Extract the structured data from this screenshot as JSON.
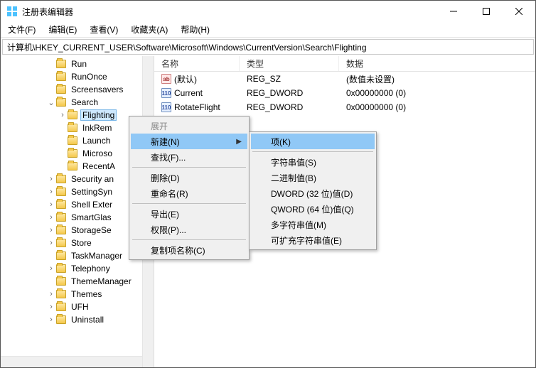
{
  "titlebar": {
    "title": "注册表编辑器"
  },
  "menubar": {
    "file": "文件(F)",
    "edit": "编辑(E)",
    "view": "查看(V)",
    "fav": "收藏夹(A)",
    "help": "帮助(H)"
  },
  "address": "计算机\\HKEY_CURRENT_USER\\Software\\Microsoft\\Windows\\CurrentVersion\\Search\\Flighting",
  "tree": {
    "items": [
      {
        "indent": 4,
        "tw": "",
        "label": "Run"
      },
      {
        "indent": 4,
        "tw": "",
        "label": "RunOnce"
      },
      {
        "indent": 4,
        "tw": "",
        "label": "Screensavers"
      },
      {
        "indent": 4,
        "tw": "v",
        "label": "Search"
      },
      {
        "indent": 5,
        "tw": ">",
        "label": "Flighting",
        "sel": true
      },
      {
        "indent": 5,
        "tw": "",
        "label": "InkRem"
      },
      {
        "indent": 5,
        "tw": "",
        "label": "Launch"
      },
      {
        "indent": 5,
        "tw": "",
        "label": "Microso"
      },
      {
        "indent": 5,
        "tw": "",
        "label": "RecentA"
      },
      {
        "indent": 4,
        "tw": ">",
        "label": "Security an"
      },
      {
        "indent": 4,
        "tw": ">",
        "label": "SettingSyn"
      },
      {
        "indent": 4,
        "tw": ">",
        "label": "Shell Exter"
      },
      {
        "indent": 4,
        "tw": ">",
        "label": "SmartGlas"
      },
      {
        "indent": 4,
        "tw": ">",
        "label": "StorageSe"
      },
      {
        "indent": 4,
        "tw": ">",
        "label": "Store"
      },
      {
        "indent": 4,
        "tw": "",
        "label": "TaskManager"
      },
      {
        "indent": 4,
        "tw": ">",
        "label": "Telephony"
      },
      {
        "indent": 4,
        "tw": "",
        "label": "ThemeManager"
      },
      {
        "indent": 4,
        "tw": ">",
        "label": "Themes"
      },
      {
        "indent": 4,
        "tw": ">",
        "label": "UFH"
      },
      {
        "indent": 4,
        "tw": ">",
        "label": "Uninstall"
      }
    ]
  },
  "list": {
    "headers": {
      "name": "名称",
      "type": "类型",
      "data": "数据"
    },
    "rows": [
      {
        "icon": "sz",
        "name": "(默认)",
        "type": "REG_SZ",
        "data": "(数值未设置)"
      },
      {
        "icon": "dw",
        "name": "Current",
        "type": "REG_DWORD",
        "data": "0x00000000 (0)"
      },
      {
        "icon": "dw",
        "name": "RotateFlight",
        "type": "REG_DWORD",
        "data": "0x00000000 (0)"
      }
    ]
  },
  "ctx1": {
    "expand": "展开",
    "new": "新建(N)",
    "find": "查找(F)...",
    "delete": "删除(D)",
    "rename": "重命名(R)",
    "export": "导出(E)",
    "perm": "权限(P)...",
    "copyname": "复制项名称(C)"
  },
  "ctx2": {
    "key": "项(K)",
    "string": "字符串值(S)",
    "binary": "二进制值(B)",
    "dword": "DWORD (32 位)值(D)",
    "qword": "QWORD (64 位)值(Q)",
    "multi": "多字符串值(M)",
    "expand": "可扩充字符串值(E)"
  }
}
